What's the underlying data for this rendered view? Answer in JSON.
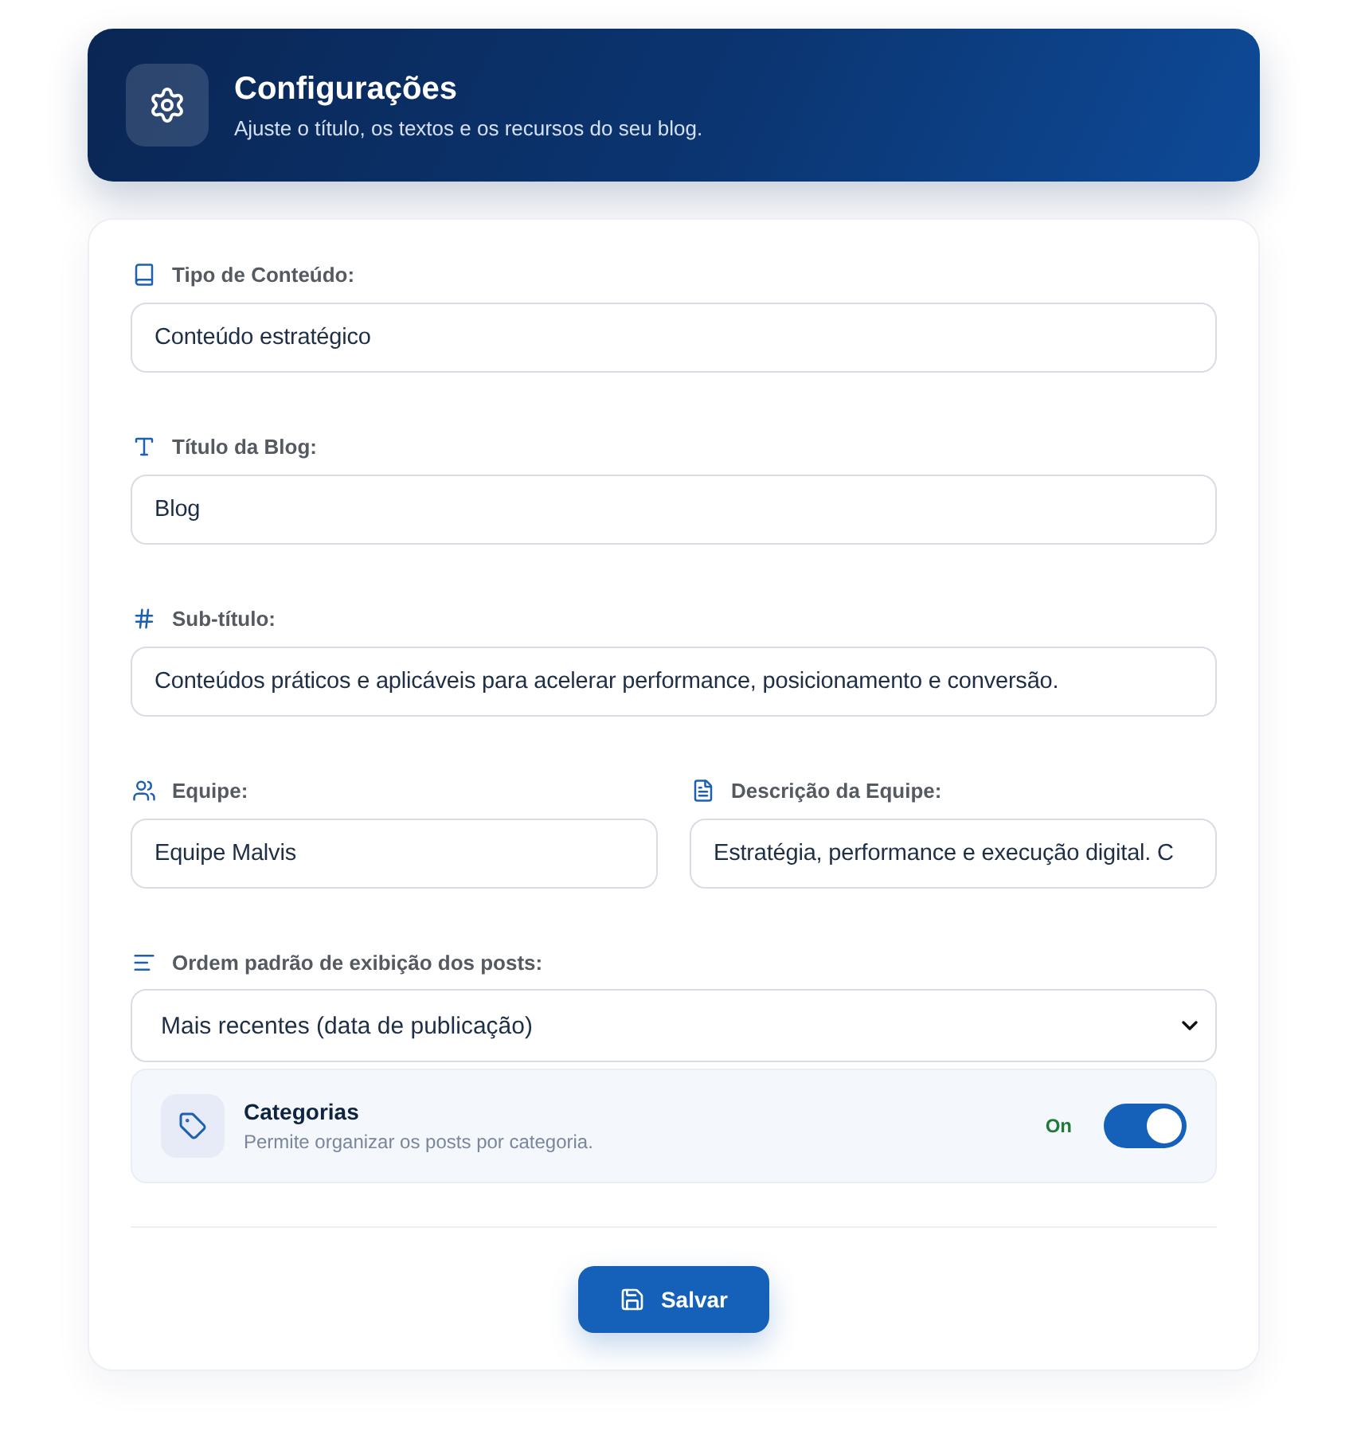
{
  "header": {
    "title": "Configurações",
    "subtitle": "Ajuste o título, os textos e os recursos do seu blog."
  },
  "form": {
    "rows": [
      {
        "fields": [
          {
            "kind": "input",
            "label": "Tipo de Conteúdo:",
            "value": "Conteúdo estratégico"
          }
        ]
      },
      {
        "fields": [
          {
            "kind": "input",
            "label": "Título da Blog:",
            "value": "Blog"
          }
        ]
      },
      {
        "fields": [
          {
            "kind": "input",
            "label": "Sub-título:",
            "value": "Conteúdos práticos e aplicáveis para acelerar performance, posicionamento e conversão."
          }
        ]
      },
      {
        "fields": [
          {
            "kind": "input",
            "label": "Equipe:",
            "value": "Equipe Malvis"
          },
          {
            "kind": "input",
            "label": "Descrição da Equipe:",
            "value": "Estratégia, performance e execução digital. C"
          }
        ]
      },
      {
        "fields": [
          {
            "kind": "select",
            "label": "Ordem padrão de exibição dos posts:",
            "value": "Mais recentes (data de publicação)"
          }
        ]
      }
    ]
  },
  "feature": {
    "title": "Categorias",
    "description": "Permite organizar os posts por categoria.",
    "status": "On",
    "on": true
  },
  "save_button": {
    "label": "Salvar"
  }
}
